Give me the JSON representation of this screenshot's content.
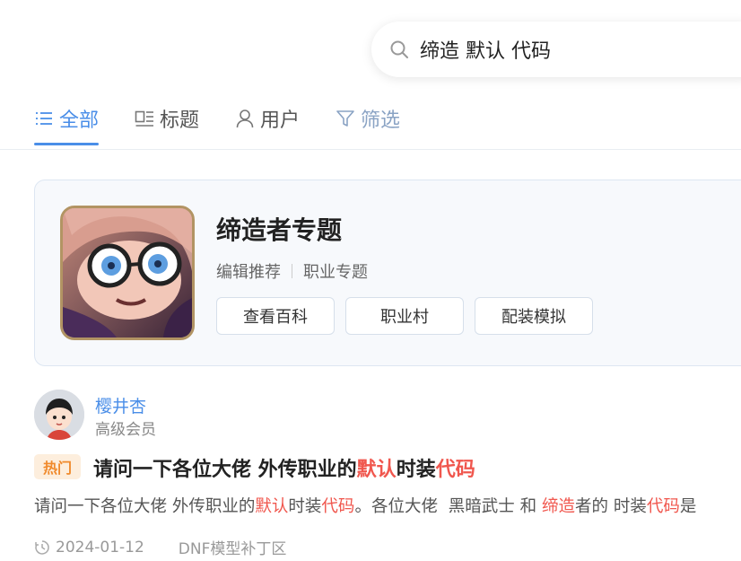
{
  "search": {
    "query": "缔造 默认 代码"
  },
  "tabs": [
    {
      "label": "全部",
      "icon": "list-icon",
      "active": true
    },
    {
      "label": "标题",
      "icon": "title-icon",
      "active": false
    },
    {
      "label": "用户",
      "icon": "user-icon",
      "active": false
    },
    {
      "label": "筛选",
      "icon": "filter-icon",
      "active": false
    }
  ],
  "topic": {
    "title": "缔造者专题",
    "tags": [
      "编辑推荐",
      "职业专题"
    ],
    "buttons": [
      "查看百科",
      "职业村",
      "配装模拟"
    ]
  },
  "post": {
    "author": {
      "name": "樱井杏",
      "rank": "高级会员"
    },
    "badge": "热门",
    "title": {
      "p1": "请问一下各位大佬 外传职业的",
      "h1": "默认",
      "p2": "时装",
      "h2": "代码"
    },
    "excerpt": {
      "p1": "请问一下各位大佬 外传职业的",
      "h1": "默认",
      "p2": "时装",
      "h2": "代码",
      "p3": "。各位大佬  黑暗武士 和 ",
      "h3": "缔造",
      "p4": "者的 时装",
      "h4": "代码",
      "p5": "是"
    },
    "date": "2024-01-12",
    "category": "DNF模型补丁区"
  },
  "colors": {
    "accent": "#4a8ee8",
    "highlight": "#f0574e",
    "hot_badge": "#f08a2c"
  }
}
